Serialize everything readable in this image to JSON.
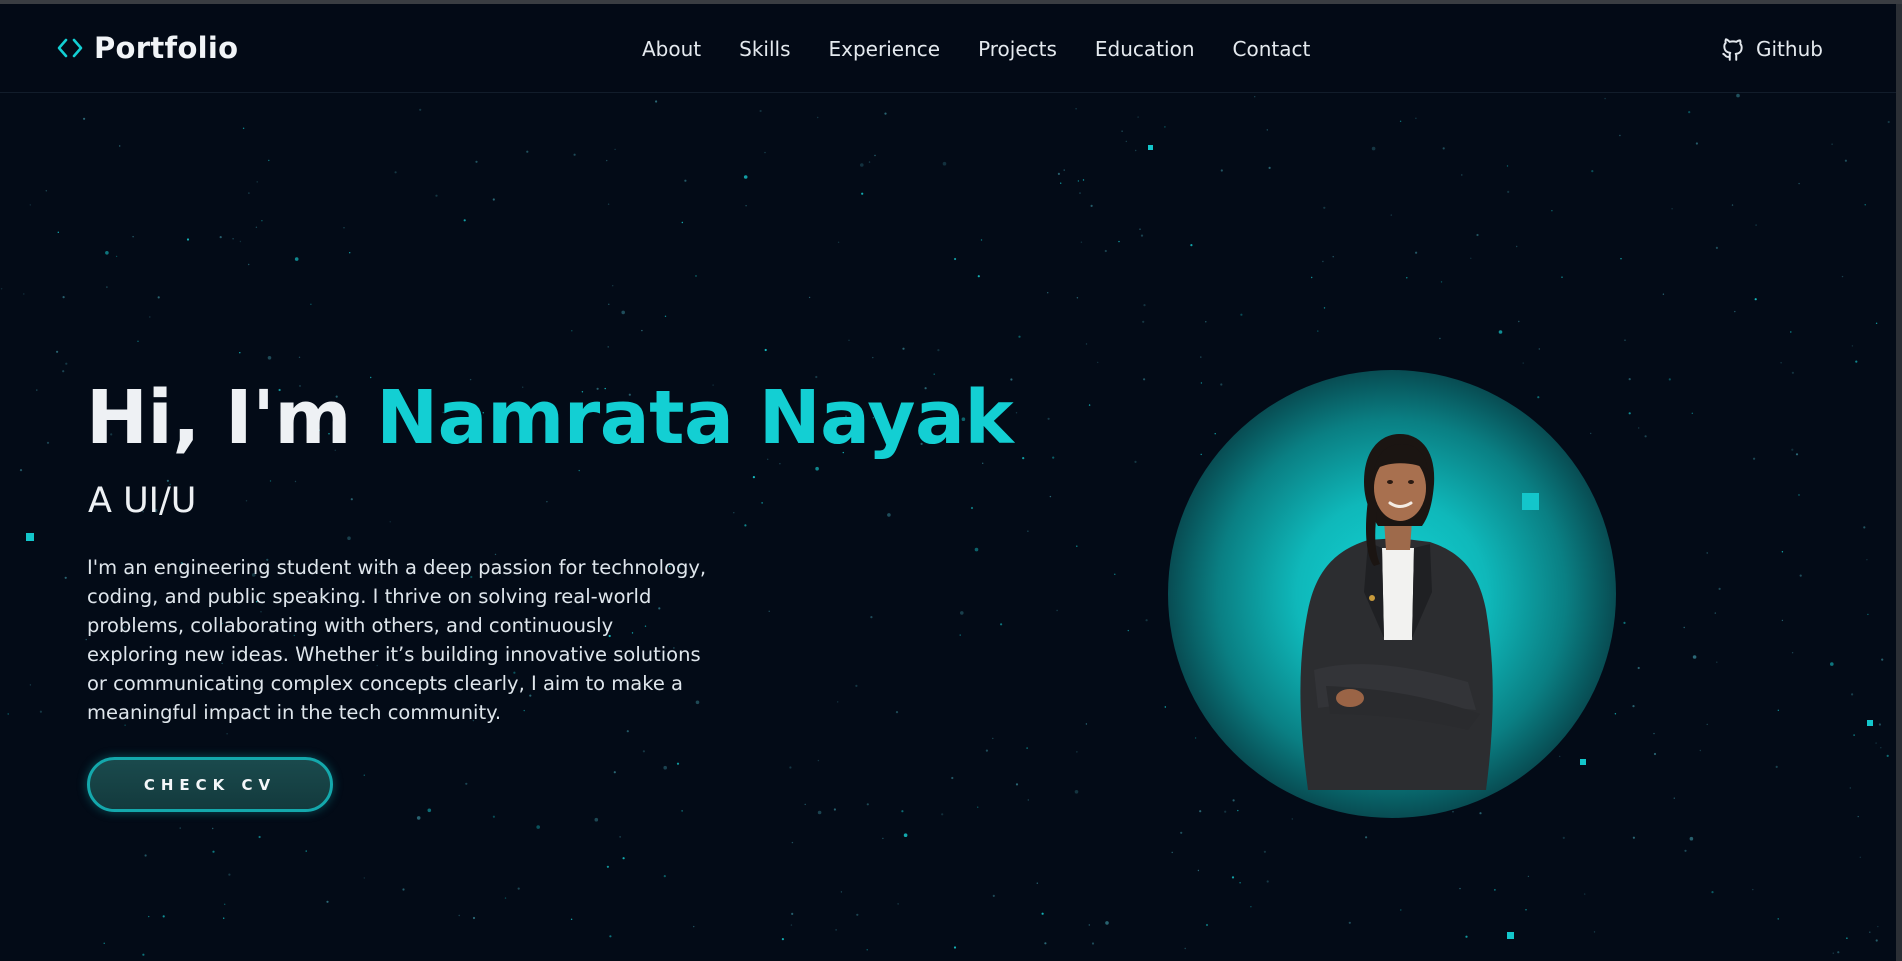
{
  "brand": {
    "logo_icon": "code-brackets-icon",
    "name": "Portfolio",
    "accent_color": "#13cfd3"
  },
  "nav": {
    "items": [
      {
        "label": "About"
      },
      {
        "label": "Skills"
      },
      {
        "label": "Experience"
      },
      {
        "label": "Projects"
      },
      {
        "label": "Education"
      },
      {
        "label": "Contact"
      }
    ],
    "github": {
      "icon": "github-icon",
      "label": "Github"
    }
  },
  "hero": {
    "greeting": "Hi, I'm ",
    "name": "Namrata Nayak",
    "subtitle": "A UI/U",
    "description": "I'm an engineering student with a deep passion for technology, coding, and public speaking. I thrive on solving real-world problems, collaborating with others, and continuously exploring new ideas. Whether it’s building innovative solutions or communicating complex concepts clearly, I aim to make a meaningful impact in the tech community.",
    "cta_label": "CHECK CV"
  },
  "colors": {
    "background": "#030b17",
    "accent": "#13cfd3",
    "text": "#eef1f4"
  }
}
